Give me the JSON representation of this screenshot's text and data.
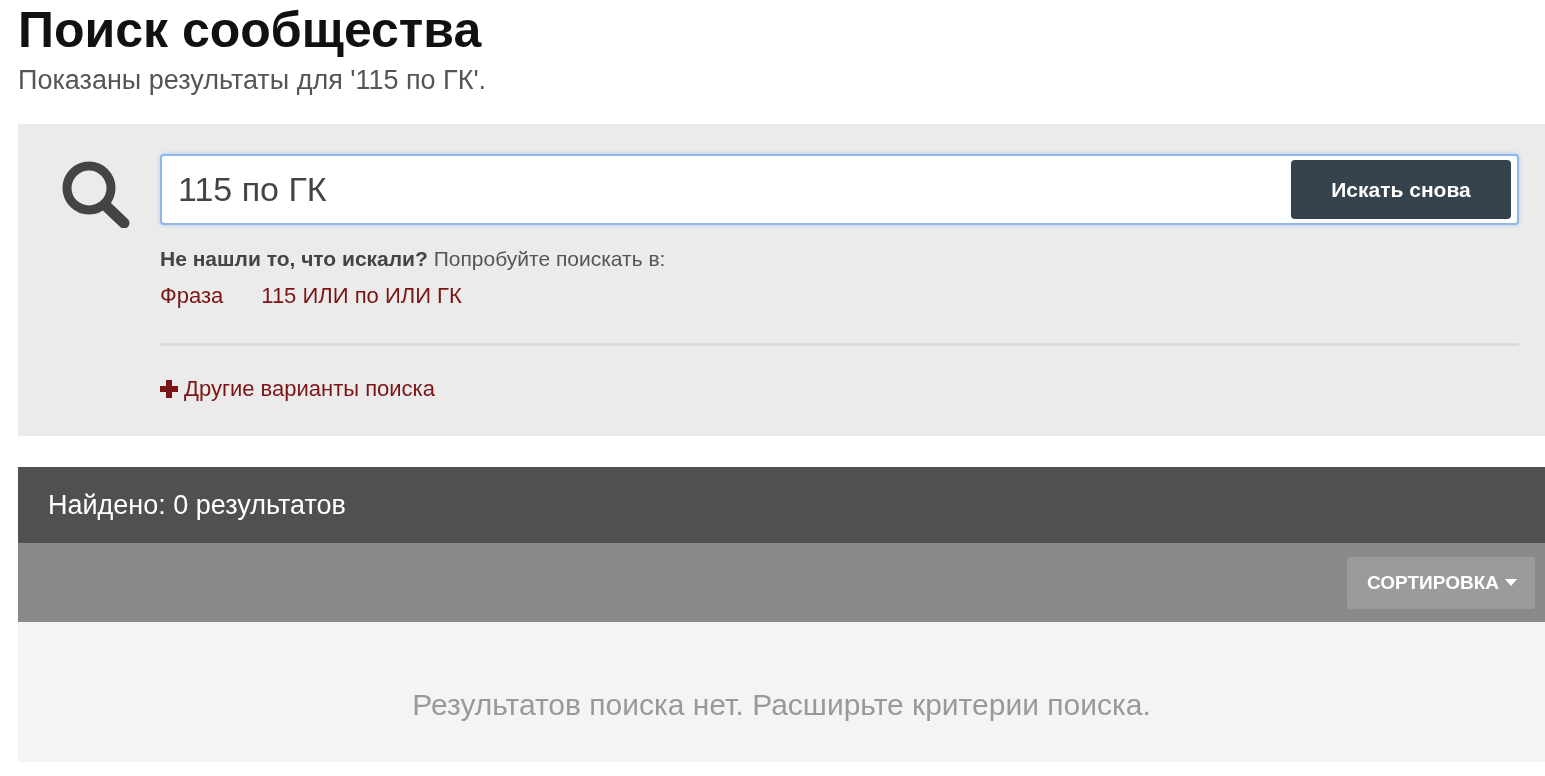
{
  "title": "Поиск сообщества",
  "subtitle": "Показаны результаты для '115 по ГК'.",
  "search": {
    "value": "115 по ГК",
    "button": "Искать снова",
    "hint": "**Не нашли то, что искали?** Попробуйте поискать в:",
    "suggestions": [
      "Фраза",
      "115 ИЛИ по ИЛИ ГК"
    ],
    "more_options": "Другие варианты поиска"
  },
  "results": {
    "count_label": "Найдено: 0 результатов",
    "sort_button": "СОРТИРОВКА",
    "empty_message": "Результатов поиска нет. Расширьте критерии поиска."
  }
}
